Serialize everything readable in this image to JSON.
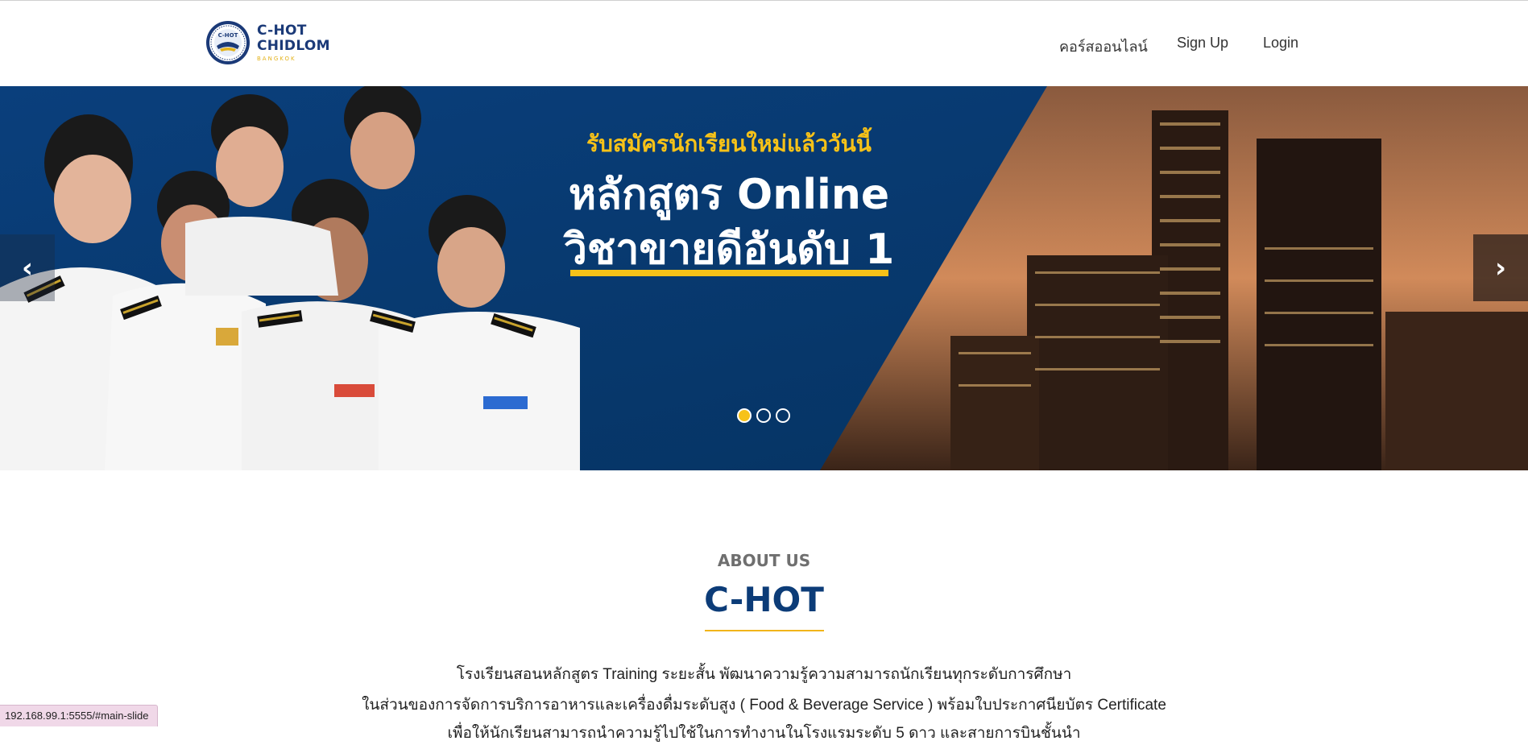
{
  "logo": {
    "line1": "C-HOT",
    "line2": "CHIDLOM",
    "line3": "BANGKOK",
    "emblem_text": "C-HOT"
  },
  "nav": {
    "items": [
      {
        "label": "คอร์สออนไลน์"
      },
      {
        "label": "Sign Up"
      },
      {
        "label": "Login"
      }
    ]
  },
  "hero": {
    "tagline": "รับสมัครนักเรียนใหม่แล้ววันนี้",
    "title_line1": "หลักสูตร Online",
    "title_line2": "วิชาขายดีอันดับ 1",
    "prev_icon": "chevron-left",
    "next_icon": "chevron-right",
    "slides_count": 3,
    "active_slide": 1
  },
  "about": {
    "label": "ABOUT US",
    "title": "C-HOT",
    "paragraph1": "โรงเรียนสอนหลักสูตร Training ระยะสั้น พัฒนาความรู้ความสามารถนักเรียนทุกระดับการศึกษา",
    "paragraph2": "ในส่วนของการจัดการบริการอาหารและเครื่องดื่มระดับสูง ( Food & Beverage Service ) พร้อมใบประกาศนียบัตร Certificate",
    "paragraph3": "เพื่อให้นักเรียนสามารถนำความรู้ไปใช้ในการทำงานในโรงแรมระดับ 5 ดาว และสายการบินชั้นนำ"
  },
  "statusbar": {
    "url": "192.168.99.1:5555/#main-slide"
  },
  "colors": {
    "brand_navy": "#0c3c78",
    "accent_yellow": "#f7c218",
    "hero_blue": "#05498a"
  }
}
